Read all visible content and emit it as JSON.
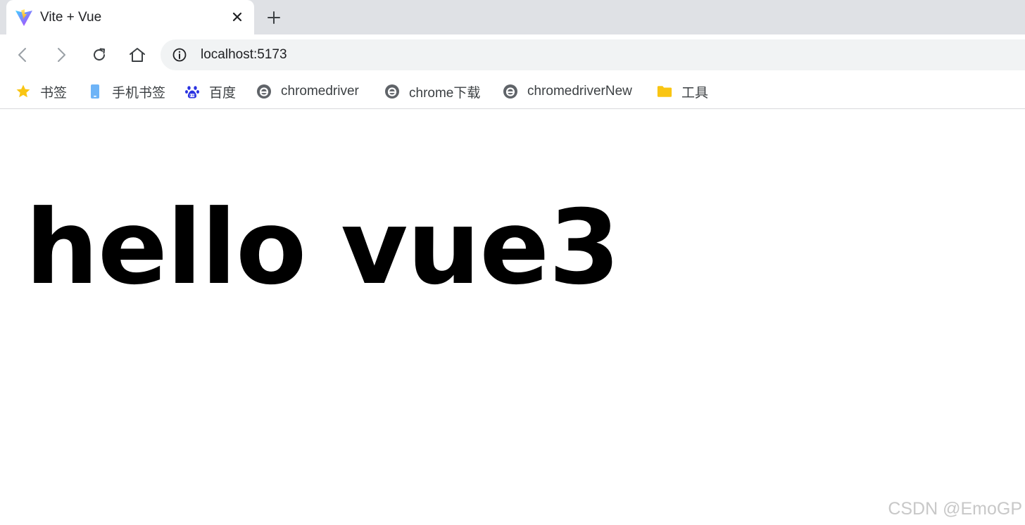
{
  "tab": {
    "title": "Vite + Vue",
    "favicon": "vite-logo-icon",
    "close_icon": "close-icon",
    "new_tab_icon": "plus-icon"
  },
  "toolbar": {
    "back_icon": "arrow-left-icon",
    "forward_icon": "arrow-right-icon",
    "reload_icon": "reload-icon",
    "home_icon": "home-icon",
    "site_info_icon": "info-icon",
    "url": "localhost:5173"
  },
  "bookmarks": [
    {
      "label": "书签",
      "icon": "star-icon"
    },
    {
      "label": "手机书签",
      "icon": "mobile-icon"
    },
    {
      "label": "百度",
      "icon": "baidu-paw-icon"
    },
    {
      "label": "chromedriver",
      "icon": "globe-e-icon"
    },
    {
      "label": "chrome下载",
      "icon": "globe-e-icon"
    },
    {
      "label": "chromedriverNew",
      "icon": "globe-e-icon"
    },
    {
      "label": "工具",
      "icon": "folder-icon"
    }
  ],
  "page": {
    "heading": "hello vue3"
  },
  "watermark": "CSDN @EmoGP",
  "colors": {
    "tabstrip": "#dfe1e5",
    "omnibox": "#f1f3f4",
    "star": "#f9c513",
    "folder": "#f9c513",
    "baidu": "#2932e1",
    "mobile": "#6eb4f7",
    "globe": "#5f6368"
  }
}
